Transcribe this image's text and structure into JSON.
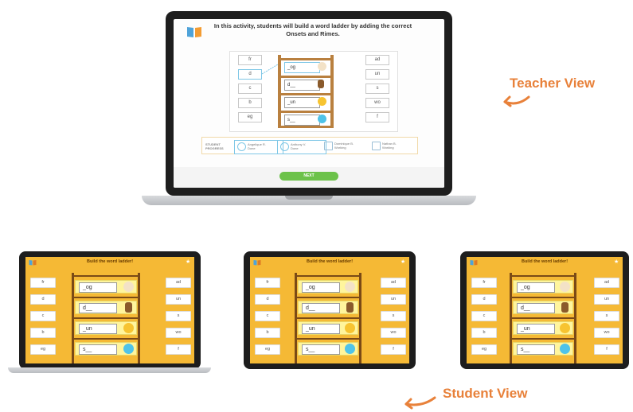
{
  "teacher": {
    "instruction": "In this activity, students will build a word ladder by adding the correct Onsets and Rimes.",
    "left_options": [
      "fr",
      "d",
      "c",
      "b",
      "eg"
    ],
    "right_options": [
      "ad",
      "un",
      "s",
      "wo",
      "f"
    ],
    "ladder": [
      "_og",
      "d__",
      "_un",
      "s__"
    ],
    "progress_label": "STUDENT PROGRESS",
    "students": [
      {
        "name": "Angelique R.",
        "status": "Done"
      },
      {
        "name": "Anthony V.",
        "status": "Done"
      },
      {
        "name": "Dominique B.",
        "status": "Working"
      },
      {
        "name": "Nathan B.",
        "status": "Working"
      }
    ],
    "next_label": "NEXT"
  },
  "student": {
    "title": "Build the word ladder!",
    "left_options": [
      "fr",
      "d",
      "c",
      "b",
      "eg"
    ],
    "right_options": [
      "ad",
      "un",
      "s",
      "wo",
      "f"
    ],
    "ladder": [
      "_og",
      "d__",
      "_un",
      "s__"
    ]
  },
  "captions": {
    "teacher_view": "Teacher View",
    "student_view": "Student View"
  },
  "colors": {
    "accent": "#e8813a",
    "student_bg": "#f5b935",
    "next_button": "#6cc24a"
  }
}
